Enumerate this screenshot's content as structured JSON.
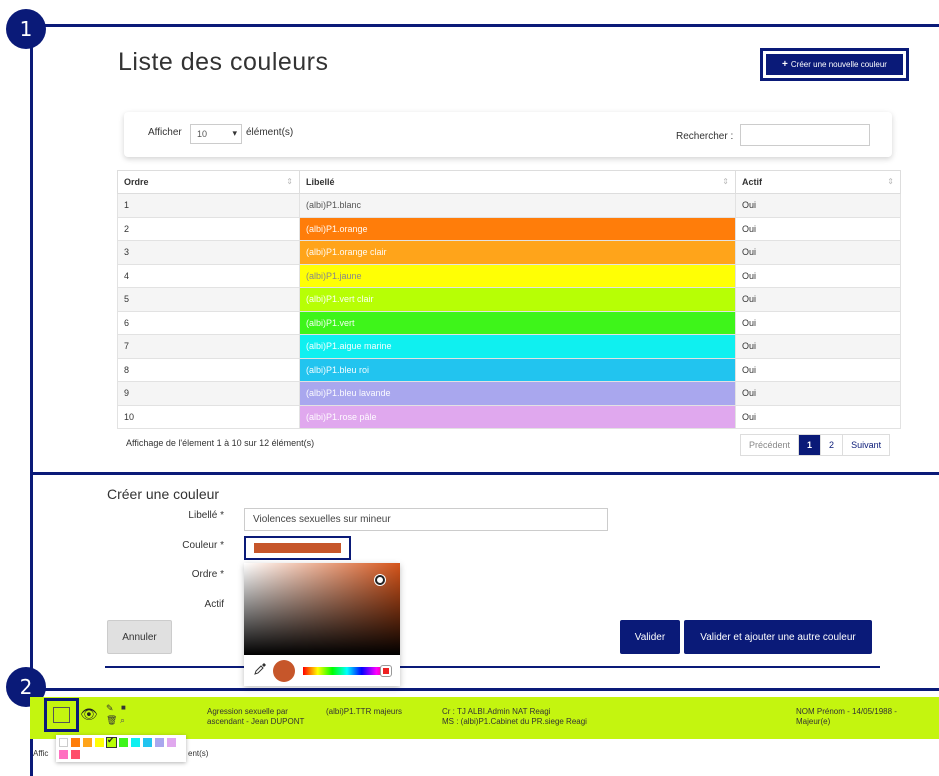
{
  "badges": [
    "1",
    "2"
  ],
  "page": {
    "title": "Liste des couleurs",
    "create_button": "Créer une nouvelle couleur"
  },
  "filter": {
    "show_label": "Afficher",
    "page_size": "10",
    "elements_label": "élément(s)",
    "search_label": "Rechercher :",
    "search_value": ""
  },
  "table": {
    "headers": [
      "Ordre",
      "Libellé",
      "Actif"
    ],
    "rows": [
      {
        "ordre": "1",
        "libelle": "(albi)P1.blanc",
        "actif": "Oui",
        "color": "#f5f5f5"
      },
      {
        "ordre": "2",
        "libelle": "(albi)P1.orange",
        "actif": "Oui",
        "color": "#ff7d0a"
      },
      {
        "ordre": "3",
        "libelle": "(albi)P1.orange clair",
        "actif": "Oui",
        "color": "#ffa41a"
      },
      {
        "ordre": "4",
        "libelle": "(albi)P1.jaune",
        "actif": "Oui",
        "color": "#ffff05"
      },
      {
        "ordre": "5",
        "libelle": "(albi)P1.vert clair",
        "actif": "Oui",
        "color": "#b7ff05"
      },
      {
        "ordre": "6",
        "libelle": "(albi)P1.vert",
        "actif": "Oui",
        "color": "#3ef51a"
      },
      {
        "ordre": "7",
        "libelle": "(albi)P1.aigue marine",
        "actif": "Oui",
        "color": "#0ff0f0"
      },
      {
        "ordre": "8",
        "libelle": "(albi)P1.bleu roi",
        "actif": "Oui",
        "color": "#22c4ef"
      },
      {
        "ordre": "9",
        "libelle": "(albi)P1.bleu lavande",
        "actif": "Oui",
        "color": "#a9a7ee"
      },
      {
        "ordre": "10",
        "libelle": "(albi)P1.rose pâle",
        "actif": "Oui",
        "color": "#e0a8ee"
      }
    ],
    "info": "Affichage de l'élement 1 à 10 sur 12 élément(s)",
    "pager": {
      "prev": "Précédent",
      "pages": [
        "1",
        "2"
      ],
      "next": "Suivant",
      "current": "1"
    }
  },
  "form": {
    "title": "Créer une couleur",
    "libelle_label": "Libellé *",
    "libelle_value": "Violences sexuelles sur mineur",
    "couleur_label": "Couleur *",
    "couleur_value": "#c6562a",
    "ordre_label": "Ordre *",
    "actif_label": "Actif",
    "cancel": "Annuler",
    "validate": "Valider",
    "validate_add": "Valider et ajouter une autre couleur"
  },
  "bottom": {
    "col1_line1": "Agression sexuelle par",
    "col1_line2": "ascendant - Jean DUPONT",
    "col2": "(albi)P1.TTR majeurs",
    "col3_line1": "Cr : TJ ALBI.Admin NAT Reagi",
    "col3_line2": "MS : (albi)P1.Cabinet du PR.siege Reagi",
    "col4_line1": "NOM Prénom - 14/05/1988 -",
    "col4_line2": "Majeur(e)",
    "info_left": "Affic",
    "info_right": "ent(s)",
    "row_color": "#c4f50f"
  },
  "palette": {
    "row1": [
      "#ffffff",
      "#ff7d0a",
      "#ffa41a",
      "#ffff05",
      "#b7ff05",
      "#3ef51a",
      "#0ff0f0",
      "#22c4ef",
      "#a9a7ee",
      "#e0a8ee"
    ],
    "row2": [
      "#ff70c0",
      "#ff4f6a"
    ],
    "selected_index": 4
  },
  "icons": [
    "eye-icon",
    "pencil-icon",
    "trash-icon",
    "folder-icon",
    "attachment-icon",
    "checkmark-icon",
    "eyedropper-icon"
  ]
}
